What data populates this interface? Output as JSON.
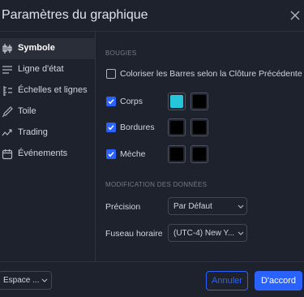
{
  "dialog": {
    "title": "Paramètres du graphique"
  },
  "sidebar": {
    "items": [
      {
        "label": "Symbole",
        "icon": "candles-icon",
        "active": true
      },
      {
        "label": "Ligne d'état",
        "icon": "status-line-icon",
        "active": false
      },
      {
        "label": "Échelles et lignes",
        "icon": "scales-icon",
        "active": false
      },
      {
        "label": "Toile",
        "icon": "brush-icon",
        "active": false
      },
      {
        "label": "Trading",
        "icon": "trading-icon",
        "active": false
      },
      {
        "label": "Événements",
        "icon": "calendar-icon",
        "active": false
      }
    ]
  },
  "bars": {
    "section_label": "BOUGIES",
    "color_by_close": {
      "label": "Coloriser les Barres selon la Clôture Précédente",
      "checked": false
    },
    "rows": [
      {
        "label": "Corps",
        "checked": true,
        "colors": [
          "#26c6da",
          "#000000"
        ]
      },
      {
        "label": "Bordures",
        "checked": true,
        "colors": [
          "#000000",
          "#000000"
        ]
      },
      {
        "label": "Mèche",
        "checked": true,
        "colors": [
          "#000000",
          "#000000"
        ]
      }
    ]
  },
  "data_mod": {
    "section_label": "MODIFICATION DES DONNÉES",
    "precision": {
      "label": "Précision",
      "value": "Par Défaut"
    },
    "timezone": {
      "label": "Fuseau horaire",
      "value": "(UTC-4) New Y..."
    }
  },
  "footer": {
    "template_value": "Espace ...",
    "cancel_label": "Annuler",
    "ok_label": "D'accord"
  },
  "colors": {
    "accent": "#2962ff",
    "background": "#1e222d",
    "active_item": "#2a2e39"
  }
}
